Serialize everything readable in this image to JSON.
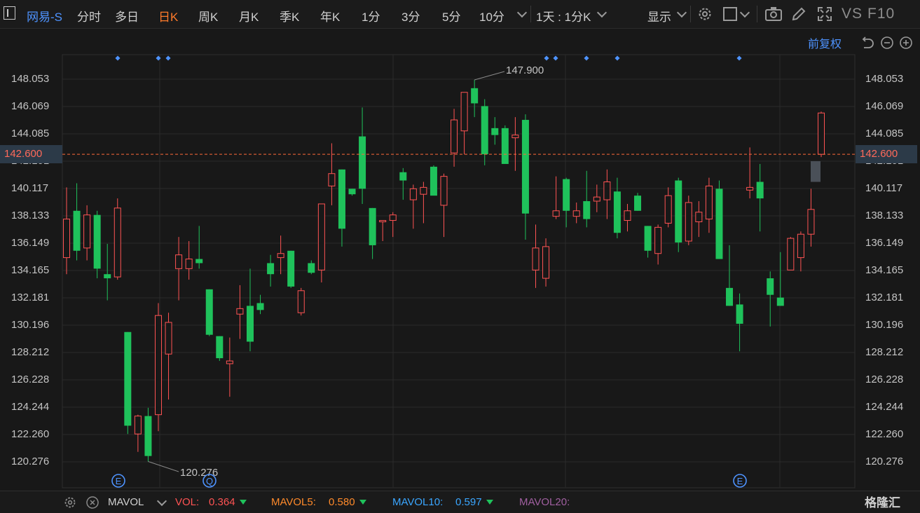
{
  "toolbar": {
    "stock_name": "网易-S",
    "tabs": [
      {
        "label": "分时"
      },
      {
        "label": "多日"
      },
      {
        "label": "日K"
      },
      {
        "label": "周K"
      },
      {
        "label": "月K"
      },
      {
        "label": "季K"
      },
      {
        "label": "年K"
      },
      {
        "label": "1分"
      },
      {
        "label": "3分"
      },
      {
        "label": "5分"
      },
      {
        "label": "10分"
      }
    ],
    "active_tab": "日K",
    "period_select": "1天 : 1分K",
    "display_label": "显示",
    "vs_label": "VS",
    "f10_label": "F10"
  },
  "chart_controls": {
    "adjust_label": "前复权"
  },
  "axis": {
    "price_ticks": [
      "148.053",
      "146.069",
      "144.085",
      "142.101",
      "140.117",
      "138.133",
      "136.149",
      "134.165",
      "132.181",
      "130.196",
      "128.212",
      "126.228",
      "124.244",
      "122.260",
      "120.276"
    ],
    "current_price": "142.600",
    "high_label": "147.900",
    "low_label": "120.276"
  },
  "event_markers": [
    "E",
    "Q",
    "E"
  ],
  "indicator_bar": {
    "name": "MAVOL",
    "vol_label": "VOL:",
    "vol_value": "0.364",
    "mavol5_label": "MAVOL5:",
    "mavol5_value": "0.580",
    "mavol10_label": "MAVOL10:",
    "mavol10_value": "0.597",
    "mavol20_label": "MAVOL20:"
  },
  "brand": "格隆汇",
  "colors": {
    "up": "#ff5353",
    "down": "#1fc25b",
    "active_tab": "#ff7a2a",
    "accent_blue": "#4e93ff",
    "mavol5": "#ff8a2a",
    "mavol10": "#3aa6ff",
    "mavol20": "#a05fa0"
  },
  "chart_data": {
    "type": "candlestick",
    "ylim": [
      119.2,
      149.8
    ],
    "price_ticks": [
      148.053,
      146.069,
      144.085,
      142.101,
      140.117,
      138.133,
      136.149,
      134.165,
      132.181,
      130.196,
      128.212,
      126.228,
      124.244,
      122.26,
      120.276
    ],
    "last_price": 142.6,
    "high": 147.9,
    "low": 120.276,
    "candles": [
      {
        "o": 135.1,
        "h": 140.2,
        "l": 133.9,
        "c": 137.9
      },
      {
        "o": 138.5,
        "h": 140.5,
        "l": 134.9,
        "c": 135.6
      },
      {
        "o": 135.8,
        "h": 138.9,
        "l": 134.9,
        "c": 138.2
      },
      {
        "o": 138.2,
        "h": 138.5,
        "l": 133.6,
        "c": 134.3
      },
      {
        "o": 133.9,
        "h": 136.1,
        "l": 132.0,
        "c": 133.6
      },
      {
        "o": 133.7,
        "h": 139.4,
        "l": 133.5,
        "c": 138.7
      },
      {
        "o": 129.7,
        "h": 129.7,
        "l": 122.3,
        "c": 122.9
      },
      {
        "o": 122.3,
        "h": 123.7,
        "l": 121.0,
        "c": 123.6
      },
      {
        "o": 123.6,
        "h": 124.2,
        "l": 120.3,
        "c": 120.7
      },
      {
        "o": 123.7,
        "h": 131.8,
        "l": 122.5,
        "c": 130.9
      },
      {
        "o": 128.1,
        "h": 131.1,
        "l": 124.8,
        "c": 130.4
      },
      {
        "o": 134.3,
        "h": 136.6,
        "l": 132.0,
        "c": 135.3
      },
      {
        "o": 134.3,
        "h": 136.3,
        "l": 133.5,
        "c": 135.0
      },
      {
        "o": 135.0,
        "h": 137.4,
        "l": 134.3,
        "c": 134.7
      },
      {
        "o": 132.8,
        "h": 132.8,
        "l": 129.4,
        "c": 129.5
      },
      {
        "o": 129.4,
        "h": 129.4,
        "l": 127.6,
        "c": 127.8
      },
      {
        "o": 127.4,
        "h": 129.3,
        "l": 125.0,
        "c": 127.6
      },
      {
        "o": 131.0,
        "h": 133.1,
        "l": 129.2,
        "c": 131.4
      },
      {
        "o": 131.6,
        "h": 134.3,
        "l": 128.3,
        "c": 129.0
      },
      {
        "o": 131.8,
        "h": 132.4,
        "l": 131.0,
        "c": 131.3
      },
      {
        "o": 134.7,
        "h": 135.3,
        "l": 133.0,
        "c": 133.9
      },
      {
        "o": 135.1,
        "h": 136.7,
        "l": 133.9,
        "c": 135.4
      },
      {
        "o": 135.6,
        "h": 135.6,
        "l": 132.9,
        "c": 133.0
      },
      {
        "o": 131.1,
        "h": 132.9,
        "l": 130.9,
        "c": 132.7
      },
      {
        "o": 134.7,
        "h": 134.9,
        "l": 133.9,
        "c": 134.0
      },
      {
        "o": 134.2,
        "h": 138.9,
        "l": 133.3,
        "c": 139.0
      },
      {
        "o": 140.3,
        "h": 143.4,
        "l": 138.9,
        "c": 141.2
      },
      {
        "o": 141.5,
        "h": 141.5,
        "l": 135.9,
        "c": 137.2
      },
      {
        "o": 140.1,
        "h": 140.1,
        "l": 139.6,
        "c": 139.7
      },
      {
        "o": 143.9,
        "h": 146.0,
        "l": 139.0,
        "c": 140.1
      },
      {
        "o": 138.7,
        "h": 138.7,
        "l": 135.0,
        "c": 136.0
      },
      {
        "o": 137.8,
        "h": 137.8,
        "l": 136.3,
        "c": 137.8
      },
      {
        "o": 137.8,
        "h": 138.4,
        "l": 136.6,
        "c": 138.2
      },
      {
        "o": 141.3,
        "h": 141.6,
        "l": 139.3,
        "c": 140.7
      },
      {
        "o": 139.3,
        "h": 140.4,
        "l": 137.2,
        "c": 140.1
      },
      {
        "o": 139.7,
        "h": 140.6,
        "l": 137.6,
        "c": 140.2
      },
      {
        "o": 141.7,
        "h": 141.8,
        "l": 139.7,
        "c": 139.6
      },
      {
        "o": 138.9,
        "h": 141.2,
        "l": 136.6,
        "c": 141.0
      },
      {
        "o": 142.7,
        "h": 145.9,
        "l": 141.7,
        "c": 145.1
      },
      {
        "o": 144.3,
        "h": 147.1,
        "l": 142.6,
        "c": 147.1
      },
      {
        "o": 147.4,
        "h": 148.0,
        "l": 145.3,
        "c": 146.3
      },
      {
        "o": 146.1,
        "h": 146.6,
        "l": 141.8,
        "c": 142.6
      },
      {
        "o": 144.5,
        "h": 145.3,
        "l": 143.3,
        "c": 144.0
      },
      {
        "o": 144.5,
        "h": 144.7,
        "l": 142.2,
        "c": 141.9
      },
      {
        "o": 143.8,
        "h": 145.3,
        "l": 141.4,
        "c": 144.0
      },
      {
        "o": 145.1,
        "h": 145.5,
        "l": 136.4,
        "c": 138.3
      },
      {
        "o": 134.2,
        "h": 137.5,
        "l": 132.9,
        "c": 135.8
      },
      {
        "o": 133.6,
        "h": 136.5,
        "l": 133.0,
        "c": 135.9
      },
      {
        "o": 138.1,
        "h": 141.0,
        "l": 137.9,
        "c": 138.5
      },
      {
        "o": 140.8,
        "h": 140.9,
        "l": 137.3,
        "c": 138.5
      },
      {
        "o": 138.1,
        "h": 139.1,
        "l": 137.6,
        "c": 138.5
      },
      {
        "o": 139.2,
        "h": 141.4,
        "l": 137.3,
        "c": 137.9
      },
      {
        "o": 139.2,
        "h": 140.4,
        "l": 138.4,
        "c": 139.5
      },
      {
        "o": 139.3,
        "h": 141.5,
        "l": 137.9,
        "c": 140.6
      },
      {
        "o": 139.9,
        "h": 140.9,
        "l": 136.5,
        "c": 136.9
      },
      {
        "o": 137.8,
        "h": 139.0,
        "l": 137.0,
        "c": 138.5
      },
      {
        "o": 139.6,
        "h": 139.8,
        "l": 138.5,
        "c": 138.5
      },
      {
        "o": 137.4,
        "h": 137.4,
        "l": 135.1,
        "c": 135.6
      },
      {
        "o": 135.4,
        "h": 137.5,
        "l": 134.6,
        "c": 137.3
      },
      {
        "o": 137.6,
        "h": 140.2,
        "l": 137.3,
        "c": 139.6
      },
      {
        "o": 140.7,
        "h": 140.9,
        "l": 135.5,
        "c": 136.2
      },
      {
        "o": 136.3,
        "h": 139.6,
        "l": 136.0,
        "c": 139.1
      },
      {
        "o": 137.7,
        "h": 139.2,
        "l": 136.6,
        "c": 138.4
      },
      {
        "o": 137.9,
        "h": 140.9,
        "l": 136.9,
        "c": 140.3
      },
      {
        "o": 140.1,
        "h": 140.7,
        "l": 135.3,
        "c": 135.0
      },
      {
        "o": 132.9,
        "h": 136.0,
        "l": 131.6,
        "c": 131.6
      },
      {
        "o": 131.7,
        "h": 132.5,
        "l": 128.3,
        "c": 130.3
      },
      {
        "o": 140.0,
        "h": 143.1,
        "l": 139.4,
        "c": 140.2
      },
      {
        "o": 140.6,
        "h": 141.9,
        "l": 137.0,
        "c": 139.4
      },
      {
        "o": 133.6,
        "h": 134.1,
        "l": 130.1,
        "c": 132.4
      },
      {
        "o": 132.2,
        "h": 135.5,
        "l": 131.6,
        "c": 131.6
      },
      {
        "o": 134.2,
        "h": 136.6,
        "l": 134.2,
        "c": 136.5
      },
      {
        "o": 135.1,
        "h": 137.0,
        "l": 134.1,
        "c": 136.8
      },
      {
        "o": 136.8,
        "h": 140.1,
        "l": 135.9,
        "c": 138.6
      },
      {
        "o": 142.6,
        "h": 145.7,
        "l": 142.4,
        "c": 145.6
      }
    ]
  }
}
